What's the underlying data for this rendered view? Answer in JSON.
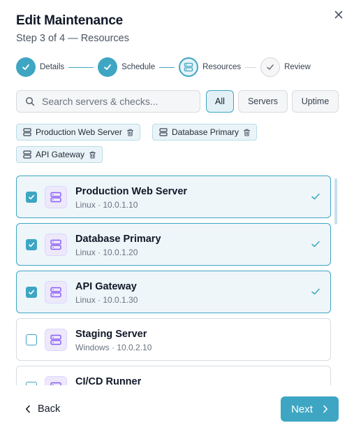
{
  "modal": {
    "title": "Edit Maintenance",
    "subtitle": "Step 3 of 4 — Resources",
    "close_icon": "close-icon"
  },
  "stepper": {
    "steps": [
      {
        "label": "Details",
        "state": "done"
      },
      {
        "label": "Schedule",
        "state": "done"
      },
      {
        "label": "Resources",
        "state": "current"
      },
      {
        "label": "Review",
        "state": "upcoming"
      }
    ]
  },
  "search": {
    "placeholder": "Search servers & checks...",
    "value": ""
  },
  "filters": {
    "options": [
      {
        "label": "All",
        "active": true
      },
      {
        "label": "Servers",
        "active": false
      },
      {
        "label": "Uptime",
        "active": false
      }
    ]
  },
  "selected_chips": [
    {
      "label": "Production Web Server"
    },
    {
      "label": "Database Primary"
    },
    {
      "label": "API Gateway"
    }
  ],
  "resources": [
    {
      "name": "Production Web Server",
      "sub": "Linux · 10.0.1.10",
      "selected": true
    },
    {
      "name": "Database Primary",
      "sub": "Linux · 10.0.1.20",
      "selected": true
    },
    {
      "name": "API Gateway",
      "sub": "Linux · 10.0.1.30",
      "selected": true
    },
    {
      "name": "Staging Server",
      "sub": "Windows · 10.0.2.10",
      "selected": false
    },
    {
      "name": "CI/CD Runner",
      "sub": "",
      "selected": false
    }
  ],
  "footer": {
    "back_label": "Back",
    "next_label": "Next"
  },
  "colors": {
    "accent": "#3ea6c3",
    "selected_bg": "#eef6f9",
    "icon_bg": "#ede9fb",
    "icon_stroke": "#8b5cf6"
  }
}
